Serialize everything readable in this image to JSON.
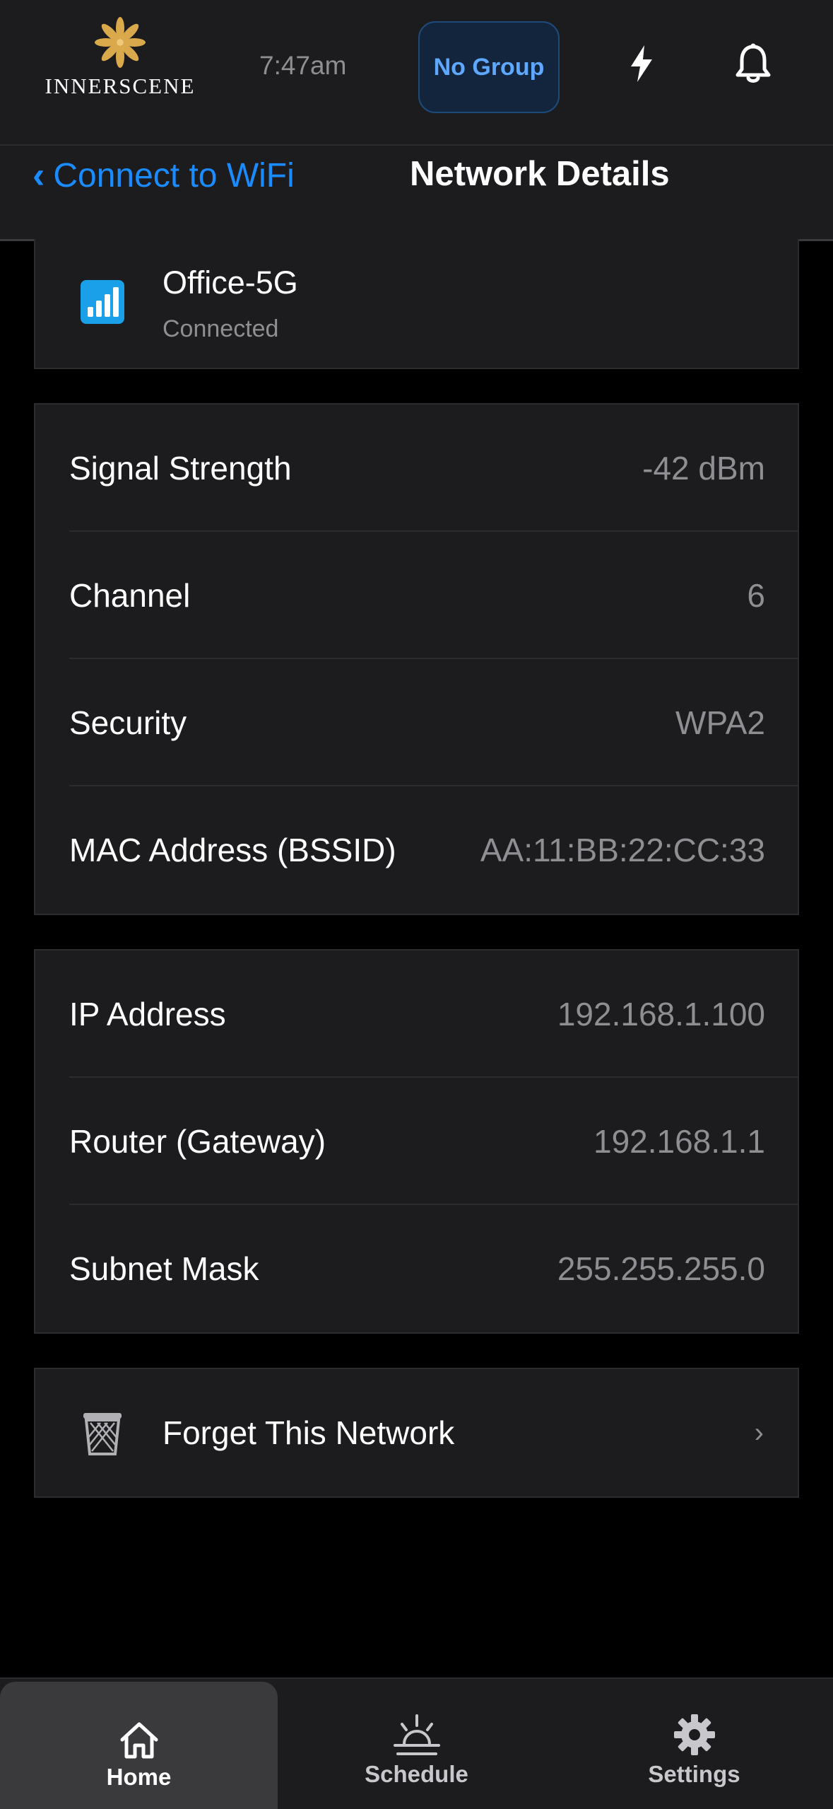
{
  "header": {
    "logo_text": "INNERSCENE",
    "time": "7:47am",
    "group_button": "No Group",
    "icons": [
      "lightning-icon",
      "bell-icon"
    ]
  },
  "nav": {
    "back_label": "Connect to WiFi",
    "title": "Network Details"
  },
  "network": {
    "name": "Office-5G",
    "status": "Connected",
    "icon": "wifi-signal-icon"
  },
  "details": [
    {
      "label": "Signal Strength",
      "value": "-42 dBm"
    },
    {
      "label": "Channel",
      "value": "6"
    },
    {
      "label": "Security",
      "value": "WPA2"
    },
    {
      "label": "MAC Address (BSSID)",
      "value": "AA:11:BB:22:CC:33"
    }
  ],
  "ip_details": [
    {
      "label": "IP Address",
      "value": "192.168.1.100"
    },
    {
      "label": "Router (Gateway)",
      "value": "192.168.1.1"
    },
    {
      "label": "Subnet Mask",
      "value": "255.255.255.0"
    }
  ],
  "forget": {
    "label": "Forget This Network",
    "chevron": "›"
  },
  "tabs": [
    {
      "label": "Home",
      "icon": "home-icon",
      "active": true
    },
    {
      "label": "Schedule",
      "icon": "sunrise-icon",
      "active": false
    },
    {
      "label": "Settings",
      "icon": "gear-icon",
      "active": false
    }
  ],
  "colors": {
    "accent": "#1a8cff",
    "background": "#000000",
    "surface": "#1c1c1e",
    "secondary_text": "#8e8e93",
    "logo_gold": "#d9a94c"
  }
}
